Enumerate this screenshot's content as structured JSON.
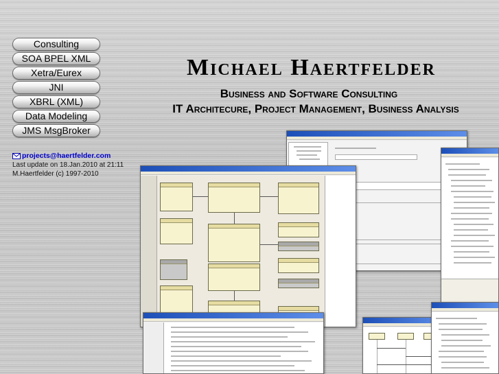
{
  "nav": {
    "items": [
      {
        "label": "Consulting"
      },
      {
        "label": "SOA BPEL XML"
      },
      {
        "label": "Xetra/Eurex"
      },
      {
        "label": "JNI"
      },
      {
        "label": "XBRL (XML)"
      },
      {
        "label": "Data Modeling"
      },
      {
        "label": "JMS MsgBroker"
      }
    ]
  },
  "contact": {
    "email": "projects@haertfelder.com",
    "last_update": "Last update on 18.Jan.2010 at 21:11",
    "copyright": "M.Haertfelder (c) 1997-2010",
    "icon": "mail-icon",
    "link_color": "#0000cc"
  },
  "header": {
    "title": "Michael Haertfelder",
    "subtitle1": "Business and Software Consulting",
    "subtitle2": "IT Architecure, Project Management, Business Analysis"
  },
  "colors": {
    "background": "#c9c9c9",
    "window_titlebar": "#1d4fb8"
  }
}
